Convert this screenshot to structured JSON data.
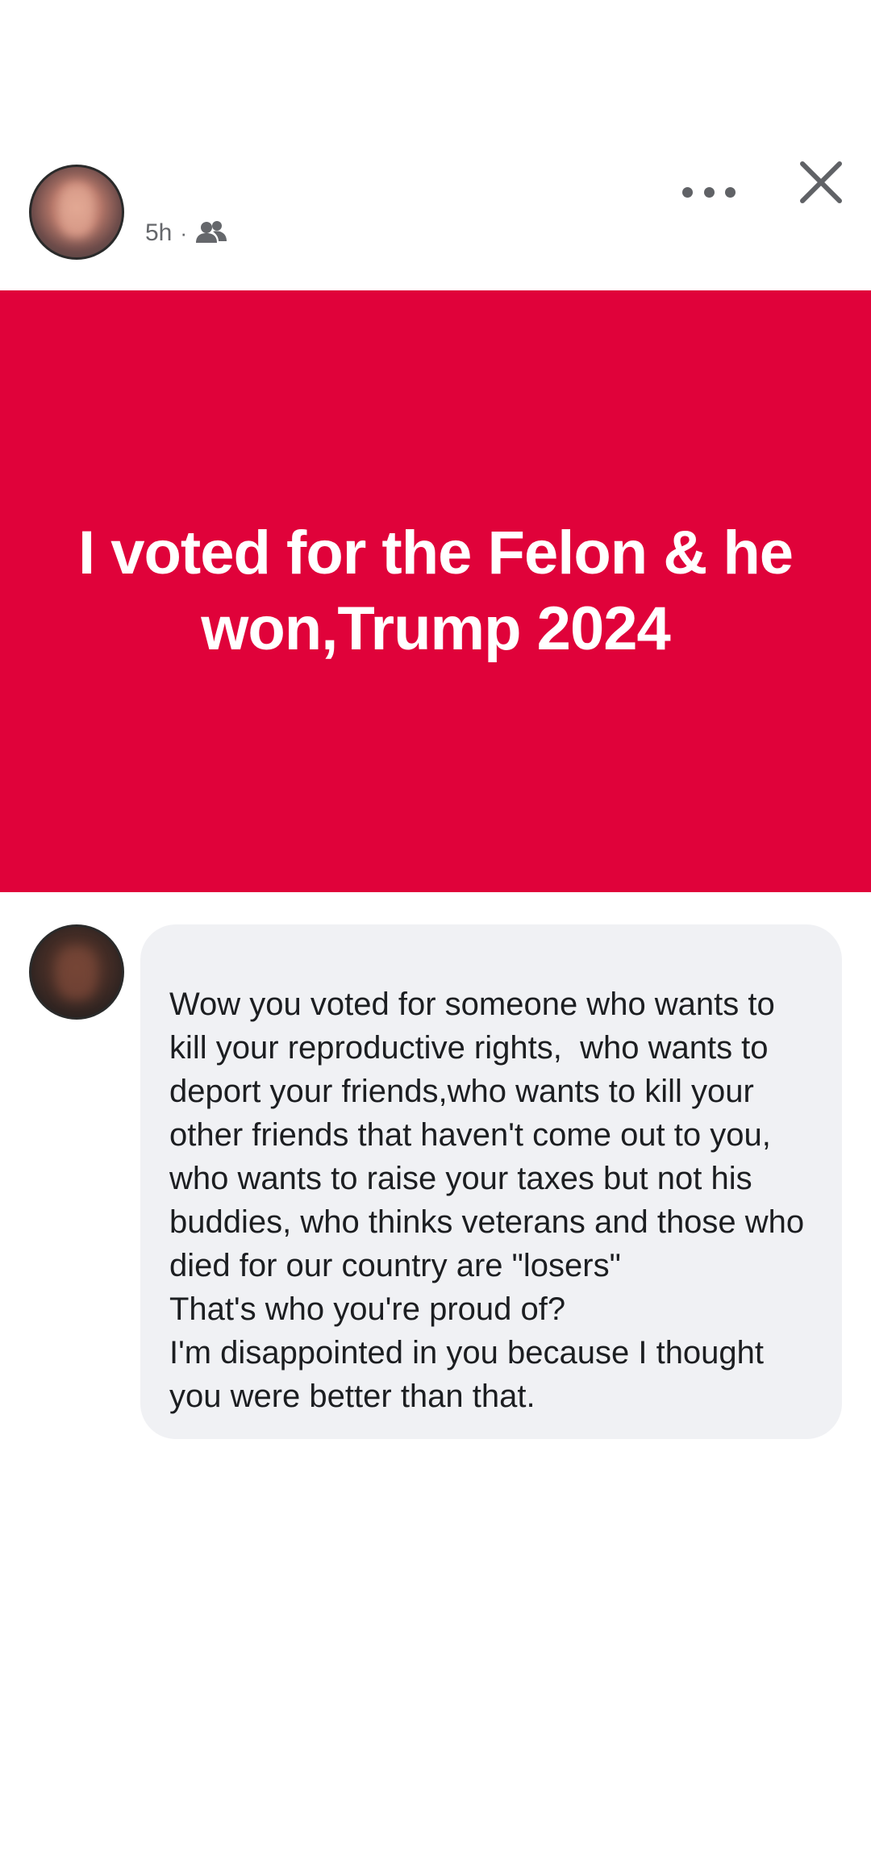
{
  "post": {
    "time": "5h",
    "separator": "·",
    "audience_icon": "friends-icon",
    "banner_text": "I voted for the Felon & he won,Trump 2024",
    "banner_color": "#e0023a"
  },
  "header": {
    "more_icon": "more-horizontal-icon",
    "close_icon": "close-icon"
  },
  "comment": {
    "text": "Wow you voted for someone who wants to kill your reproductive rights,  who wants to deport your friends,who wants to kill your other friends that haven't come out to you, who wants to raise your taxes but not his buddies, who thinks veterans and those who died for our country are \"losers\"\nThat's who you're proud of?\nI'm disappointed in you because I thought you were better than that."
  }
}
